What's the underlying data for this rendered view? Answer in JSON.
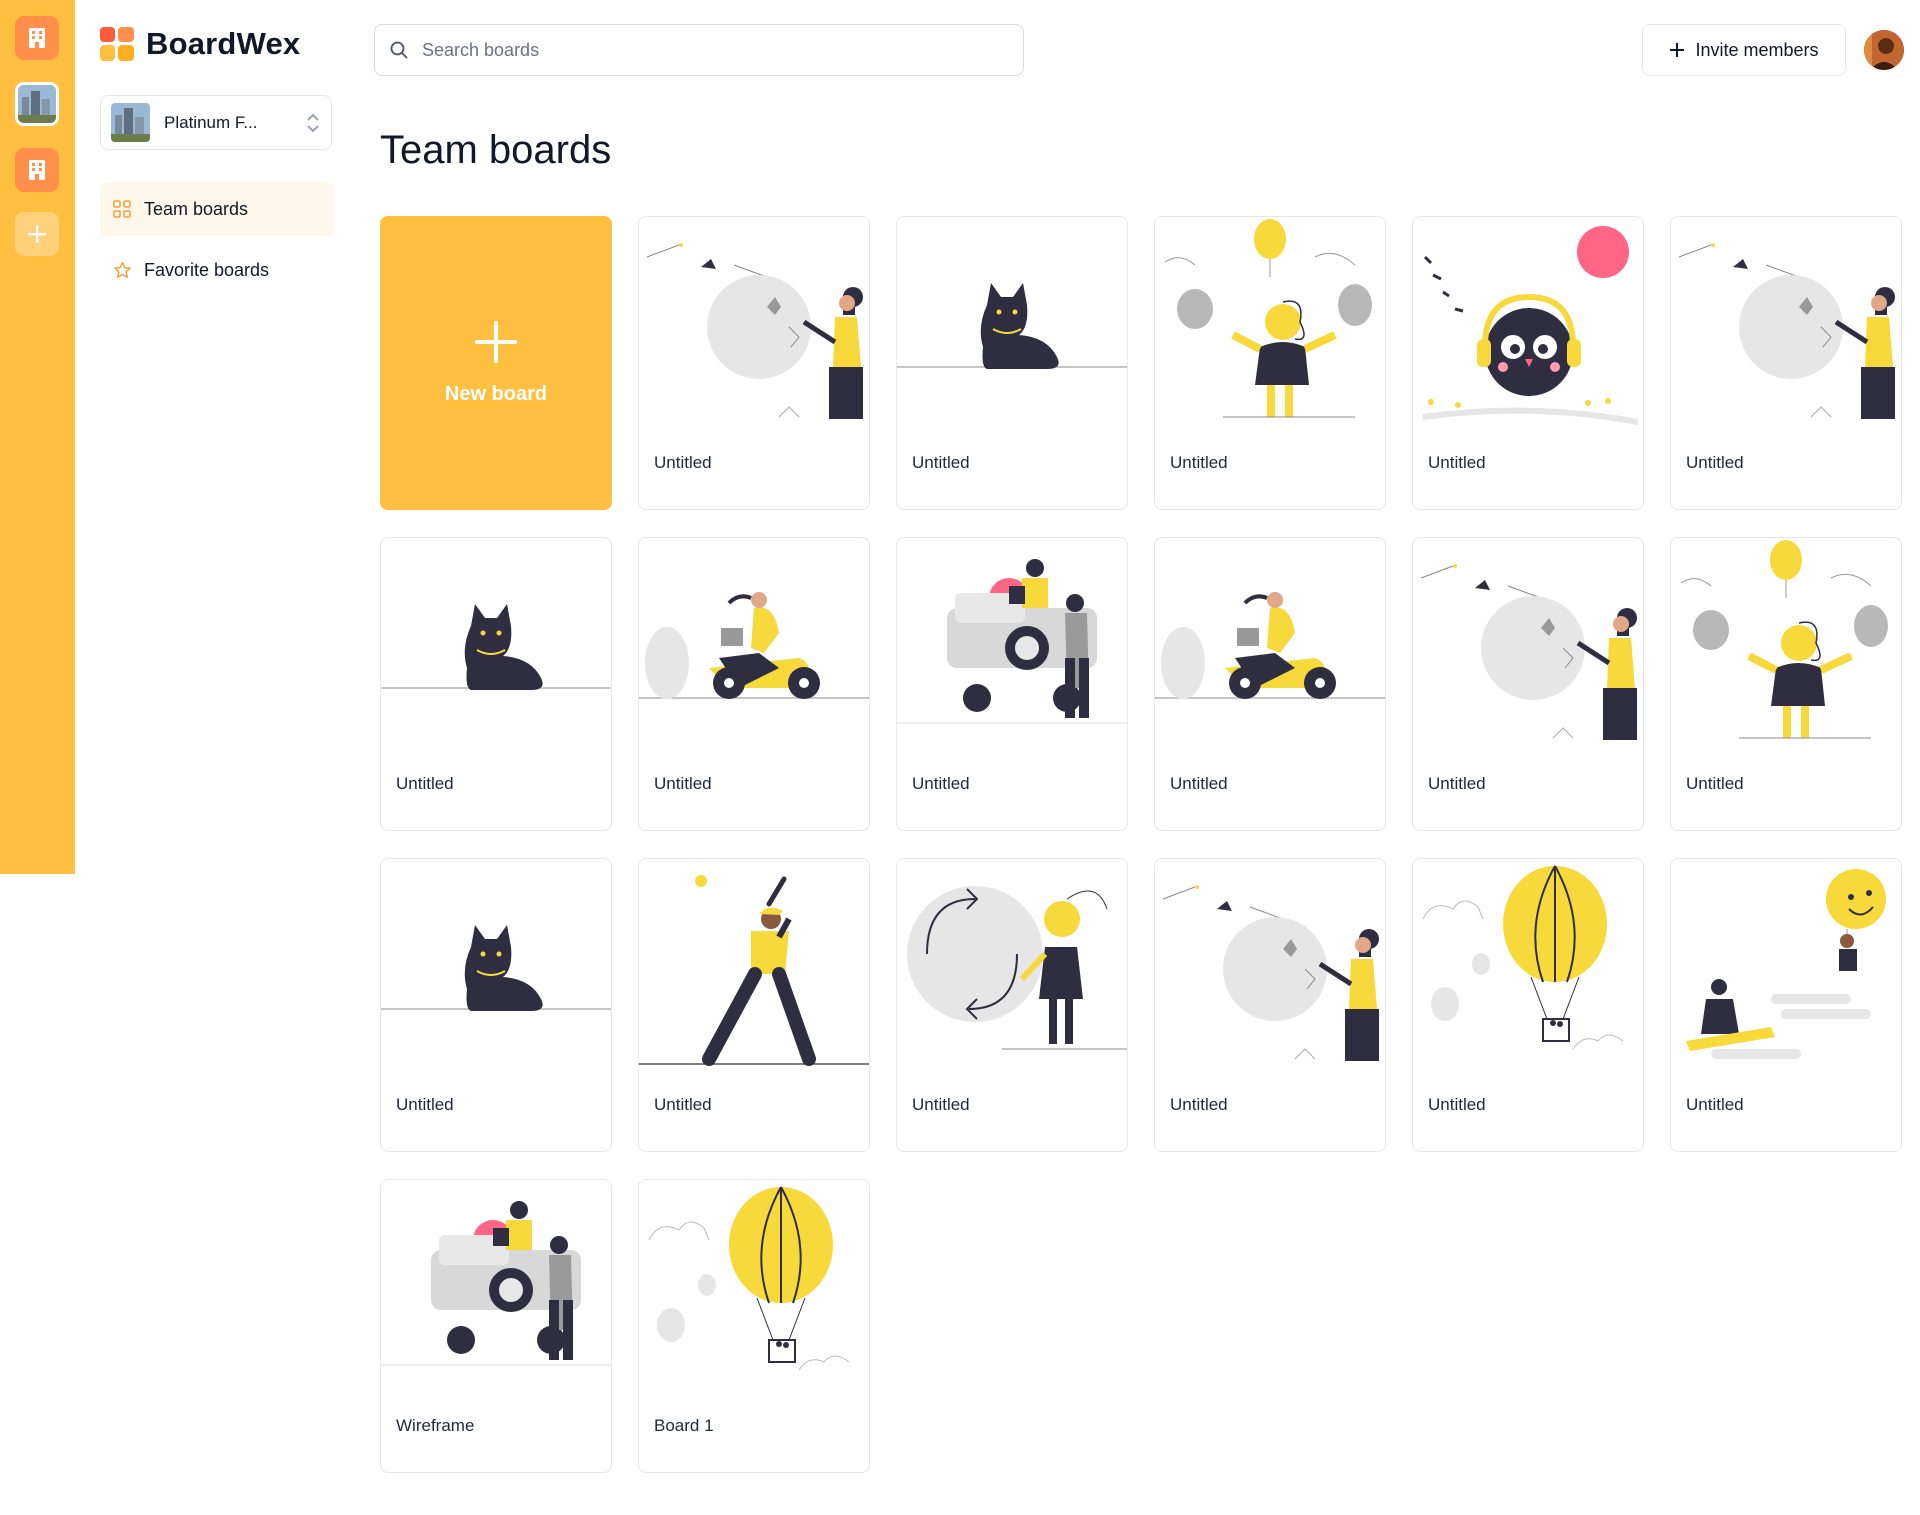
{
  "app": {
    "name": "BoardWex"
  },
  "org_rail": {
    "items": [
      {
        "kind": "org",
        "icon": "building-icon",
        "color": "#ff8f4a"
      },
      {
        "kind": "org",
        "icon": "city-photo",
        "selected": true
      },
      {
        "kind": "org",
        "icon": "building-icon",
        "color": "#ff8f4a"
      }
    ],
    "add_icon": "plus-icon"
  },
  "sidebar": {
    "org_switcher": {
      "name": "Platinum F...",
      "icon": "chevron-updown-icon"
    },
    "nav": [
      {
        "label": "Team boards",
        "icon": "grid-icon",
        "active": true
      },
      {
        "label": "Favorite boards",
        "icon": "star-icon",
        "active": false
      }
    ]
  },
  "header": {
    "search": {
      "placeholder": "Search boards",
      "value": ""
    },
    "invite_label": "Invite members"
  },
  "main": {
    "title": "Team boards",
    "new_board_label": "New board",
    "boards": [
      {
        "title": "Untitled",
        "illustration": "fishing"
      },
      {
        "title": "Untitled",
        "illustration": "cat"
      },
      {
        "title": "Untitled",
        "illustration": "balloons"
      },
      {
        "title": "Untitled",
        "illustration": "music-bird"
      },
      {
        "title": "Untitled",
        "illustration": "fishing"
      },
      {
        "title": "Untitled",
        "illustration": "cat"
      },
      {
        "title": "Untitled",
        "illustration": "scooter"
      },
      {
        "title": "Untitled",
        "illustration": "jeep"
      },
      {
        "title": "Untitled",
        "illustration": "scooter"
      },
      {
        "title": "Untitled",
        "illustration": "fishing"
      },
      {
        "title": "Untitled",
        "illustration": "balloons"
      },
      {
        "title": "Untitled",
        "illustration": "cat"
      },
      {
        "title": "Untitled",
        "illustration": "baseball"
      },
      {
        "title": "Untitled",
        "illustration": "circle-arrows"
      },
      {
        "title": "Untitled",
        "illustration": "fishing"
      },
      {
        "title": "Untitled",
        "illustration": "hot-air-balloon"
      },
      {
        "title": "Untitled",
        "illustration": "smiley-balloon"
      },
      {
        "title": "Wireframe",
        "illustration": "jeep"
      },
      {
        "title": "Board 1",
        "illustration": "hot-air-balloon"
      }
    ]
  },
  "colors": {
    "brand_yellow": "#ffc042",
    "accent_orange": "#ff8f4a",
    "illustration_yellow": "#f7d93b",
    "illustration_dark": "#2f2e41",
    "illustration_pink": "#ff6584"
  }
}
